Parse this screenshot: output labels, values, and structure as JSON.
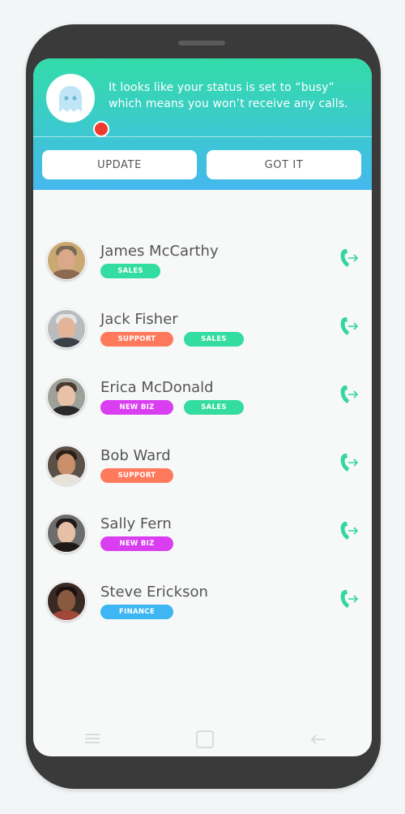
{
  "banner": {
    "message": "It looks like your status is set to “busy” which means you won’t receive any calls.",
    "update_label": "UPDATE",
    "gotit_label": "GOT IT",
    "status_color": "#ee3b2f"
  },
  "colors": {
    "sales": "#33dca0",
    "support": "#ff7a5c",
    "newbiz": "#d93ff0",
    "finance": "#3eb6f4",
    "call_icon": "#33d6a2"
  },
  "contacts": [
    {
      "name": "James McCarthy",
      "tags": [
        {
          "label": "SALES",
          "type": "sales"
        }
      ]
    },
    {
      "name": "Jack Fisher",
      "tags": [
        {
          "label": "SUPPORT",
          "type": "support"
        },
        {
          "label": "SALES",
          "type": "sales"
        }
      ]
    },
    {
      "name": "Erica McDonald",
      "tags": [
        {
          "label": "NEW BIZ",
          "type": "newbiz"
        },
        {
          "label": "SALES",
          "type": "sales"
        }
      ]
    },
    {
      "name": "Bob Ward",
      "tags": [
        {
          "label": "SUPPORT",
          "type": "support"
        }
      ]
    },
    {
      "name": "Sally Fern",
      "tags": [
        {
          "label": "NEW BIZ",
          "type": "newbiz"
        }
      ]
    },
    {
      "name": "Steve Erickson",
      "tags": [
        {
          "label": "FINANCE",
          "type": "finance"
        }
      ]
    }
  ],
  "icons": {
    "avatar_placeholder": "ghost-icon",
    "call": "phone-transfer-icon"
  }
}
